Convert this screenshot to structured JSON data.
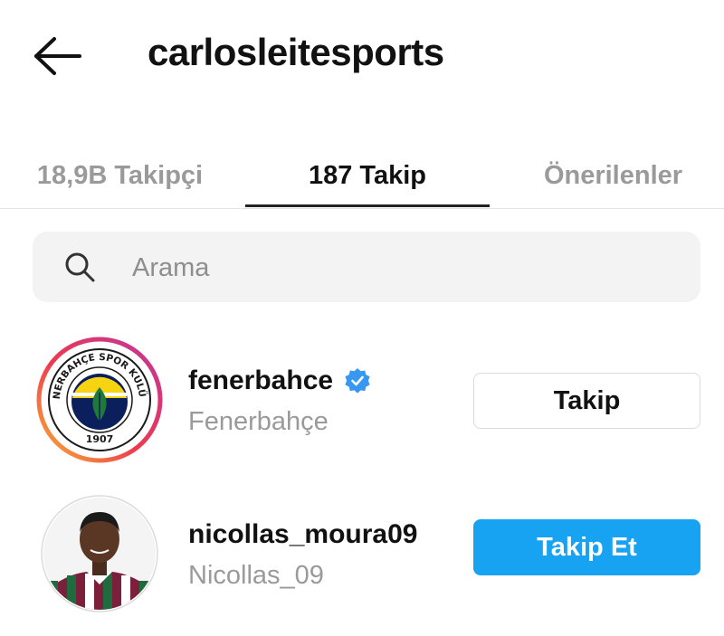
{
  "header": {
    "back_icon": "arrow-left-icon",
    "title": "carlosleitesports"
  },
  "tabs": [
    {
      "label": "18,9B Takipçi",
      "active": false
    },
    {
      "label": "187 Takip",
      "active": true
    },
    {
      "label": "Önerilenler",
      "active": false
    }
  ],
  "search": {
    "icon": "search-icon",
    "placeholder": "Arama",
    "value": ""
  },
  "list": [
    {
      "username": "fenerbahce",
      "full_name": "Fenerbahçe",
      "verified": true,
      "button_label": "Takip",
      "has_story_ring": true,
      "avatar": {
        "type": "club-crest",
        "ring_text": "FENERBAHÇE SPOR KULÜBÜ",
        "year": "1907"
      }
    },
    {
      "username": "nicollas_moura09",
      "full_name": "Nicollas_09",
      "verified": false,
      "button_label": "Takip Et",
      "has_story_ring": false,
      "avatar": {
        "type": "photo"
      }
    }
  ],
  "colors": {
    "primary_blue": "#17a3f2",
    "verified_blue": "#3897f0",
    "muted_text": "#9a9a9a",
    "crest_yellow": "#f6d411",
    "crest_navy": "#0b1f5c",
    "crest_green": "#1f7a3a"
  }
}
